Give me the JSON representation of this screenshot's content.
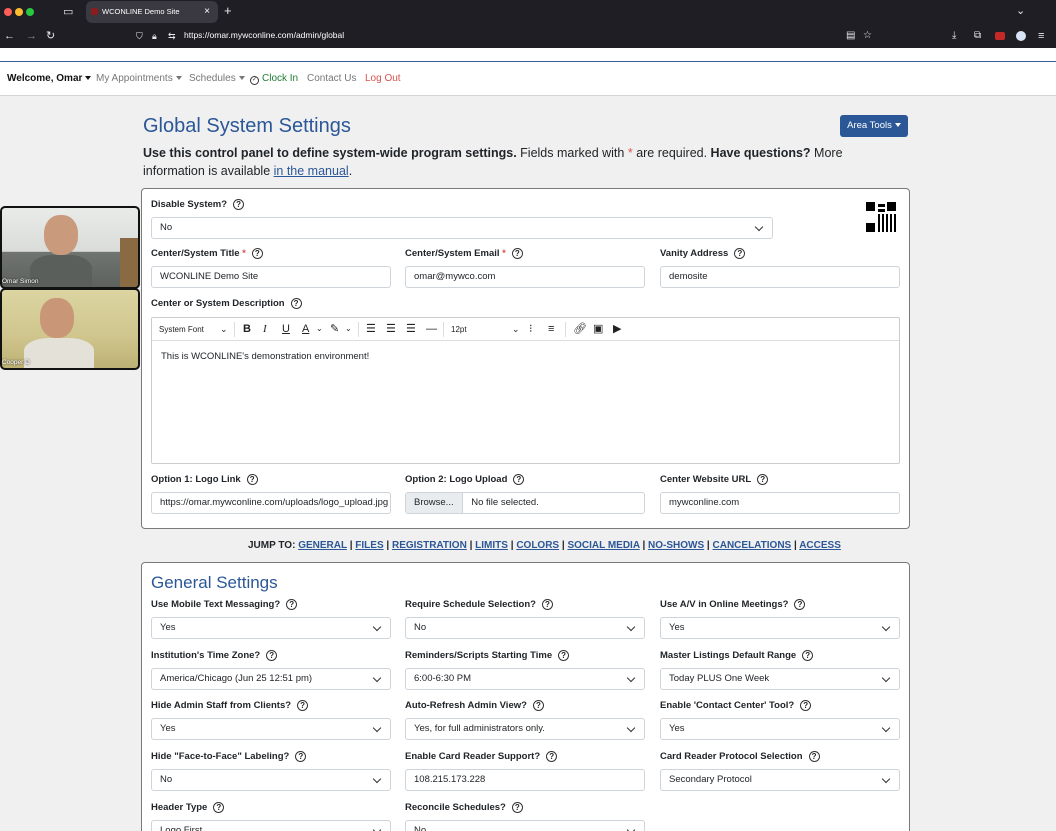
{
  "browser": {
    "tab_title": "WCONLINE Demo Site",
    "url": "https://omar.mywconline.com/admin/global"
  },
  "nav": {
    "welcome": "Welcome, Omar",
    "appointments": "My Appointments",
    "schedules": "Schedules",
    "clock_in": "Clock In",
    "contact": "Contact Us",
    "logout": "Log Out"
  },
  "header": {
    "title": "Global System Settings",
    "area_tools": "Area Tools",
    "intro_bold": "Use this control panel to define system-wide program settings.",
    "intro_rest": " Fields marked with ",
    "intro_star": "*",
    "intro_rest2": " are required. ",
    "intro_bold2": "Have questions?",
    "intro_rest3": " More information is available ",
    "manual_link": "in the manual",
    "period": "."
  },
  "system": {
    "disable_label": "Disable System?",
    "disable_value": "No",
    "title_label": "Center/System Title",
    "title_value": "WCONLINE Demo Site",
    "email_label": "Center/System Email",
    "email_value": "omar@mywco.com",
    "vanity_label": "Vanity Address",
    "vanity_value": "demosite",
    "desc_label": "Center or System Description",
    "editor": {
      "font": "System Font",
      "size": "12pt",
      "content": "This is WCONLINE's demonstration environment!"
    },
    "logo_link_label": "Option 1: Logo Link",
    "logo_link_value": "https://omar.mywconline.com/uploads/logo_upload.jpg",
    "logo_upload_label": "Option 2: Logo Upload",
    "browse": "Browse...",
    "no_file": "No file selected.",
    "website_label": "Center Website URL",
    "website_value": "mywconline.com"
  },
  "jump": {
    "label": "JUMP TO:",
    "links": [
      "GENERAL",
      "FILES",
      "REGISTRATION",
      "LIMITS",
      "COLORS",
      "SOCIAL MEDIA",
      "NO-SHOWS",
      "CANCELATIONS",
      "ACCESS"
    ]
  },
  "general": {
    "title": "General Settings",
    "fields": [
      {
        "label": "Use Mobile Text Messaging?",
        "value": "Yes"
      },
      {
        "label": "Require Schedule Selection?",
        "value": "No"
      },
      {
        "label": "Use A/V in Online Meetings?",
        "value": "Yes"
      },
      {
        "label": "Institution's Time Zone?",
        "value": "America/Chicago (Jun 25 12:51 pm)"
      },
      {
        "label": "Reminders/Scripts Starting Time",
        "value": "6:00-6:30 PM"
      },
      {
        "label": "Master Listings Default Range",
        "value": "Today PLUS One Week"
      },
      {
        "label": "Hide Admin Staff from Clients?",
        "value": "Yes"
      },
      {
        "label": "Auto-Refresh Admin View?",
        "value": "Yes, for full administrators only."
      },
      {
        "label": "Enable 'Contact Center' Tool?",
        "value": "Yes"
      },
      {
        "label": "Hide \"Face-to-Face\" Labeling?",
        "value": "No"
      },
      {
        "label": "Enable Card Reader Support?",
        "value": "108.215.173.228"
      },
      {
        "label": "Card Reader Protocol Selection",
        "value": "Secondary Protocol"
      },
      {
        "label": "Header Type",
        "value": "Logo First"
      },
      {
        "label": "Reconcile Schedules?",
        "value": "No"
      }
    ]
  },
  "video": {
    "person1": "Omar Simon",
    "person2": "Cooper D"
  },
  "colors": {
    "accent": "#2b5797",
    "danger": "#d9534f",
    "success": "#1e7e34"
  }
}
